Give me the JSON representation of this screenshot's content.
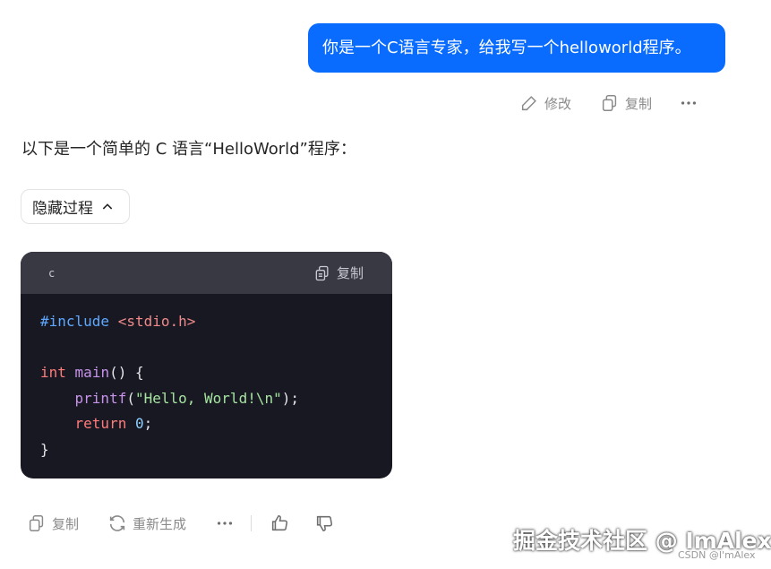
{
  "user_message": {
    "text": "你是一个C语言专家，给我写一个helloworld程序。",
    "actions": {
      "edit": "修改",
      "copy": "复制"
    }
  },
  "answer": {
    "intro": "以下是一个简单的 C 语言“HelloWorld”程序：",
    "toggle_label": "隐藏过程",
    "code": {
      "language": "c",
      "copy_label": "复制",
      "lines": [
        [
          {
            "t": "#include",
            "c": "dir"
          },
          {
            "t": " ",
            "c": "p"
          },
          {
            "t": "<stdio.h>",
            "c": "inc"
          }
        ],
        [],
        [
          {
            "t": "int",
            "c": "kw"
          },
          {
            "t": " ",
            "c": "p"
          },
          {
            "t": "main",
            "c": "fn"
          },
          {
            "t": "() {",
            "c": "p"
          }
        ],
        [
          {
            "t": "    ",
            "c": "p"
          },
          {
            "t": "printf",
            "c": "fn"
          },
          {
            "t": "(",
            "c": "p"
          },
          {
            "t": "\"Hello, World!\\n\"",
            "c": "str"
          },
          {
            "t": ");",
            "c": "p"
          }
        ],
        [
          {
            "t": "    ",
            "c": "p"
          },
          {
            "t": "return",
            "c": "kw"
          },
          {
            "t": " ",
            "c": "p"
          },
          {
            "t": "0",
            "c": "num"
          },
          {
            "t": ";",
            "c": "p"
          }
        ],
        [
          {
            "t": "}",
            "c": "p"
          }
        ]
      ]
    },
    "actions": {
      "copy": "复制",
      "regenerate": "重新生成"
    }
  },
  "watermark": {
    "text": "掘金技术社区 @ ImAlex",
    "sub": "CSDN @I'mAlex"
  },
  "icons": {
    "edit": "pencil-icon",
    "copy": "copy-icon",
    "more": "more-dots-icon",
    "chevron": "chevron-up-icon",
    "regenerate": "refresh-icon",
    "like": "thumbs-up-icon",
    "dislike": "thumbs-down-icon"
  },
  "colors": {
    "accent": "#0a6cff",
    "code_bg": "#171821",
    "code_header": "#383943"
  }
}
